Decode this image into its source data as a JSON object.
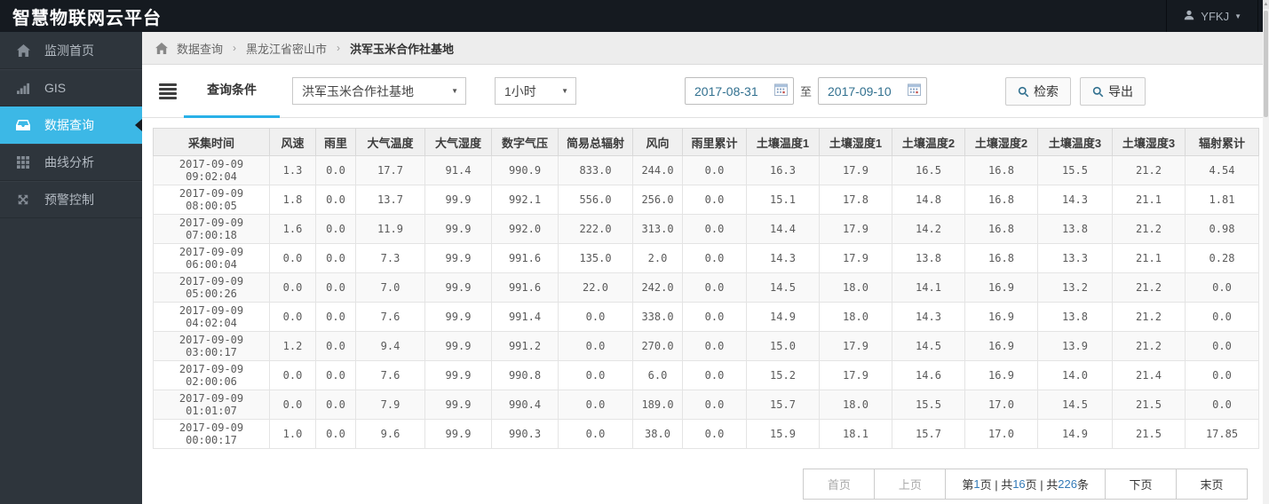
{
  "app": {
    "title": "智慧物联网云平台"
  },
  "user": {
    "name": "YFKJ"
  },
  "sidebar": {
    "items": [
      {
        "id": "monitor-home",
        "label": "监测首页",
        "icon": "home-icon",
        "active": false
      },
      {
        "id": "gis",
        "label": "GIS",
        "icon": "signal-bars-icon",
        "active": false
      },
      {
        "id": "data-query",
        "label": "数据查询",
        "icon": "inbox-icon",
        "active": true
      },
      {
        "id": "curve-analysis",
        "label": "曲线分析",
        "icon": "grid-icon",
        "active": false
      },
      {
        "id": "alert-control",
        "label": "预警控制",
        "icon": "expand-arrows-icon",
        "active": false
      }
    ]
  },
  "breadcrumb": {
    "items": [
      "数据查询",
      "黑龙江省密山市",
      "洪军玉米合作社基地"
    ]
  },
  "query": {
    "panel_label": "查询条件",
    "site_selected": "洪军玉米合作社基地",
    "interval_selected": "1小时",
    "date_from": "2017-08-31",
    "to_label": "至",
    "date_to": "2017-09-10",
    "search_label": "检索",
    "export_label": "导出"
  },
  "table": {
    "headers": [
      "采集时间",
      "风速",
      "雨里",
      "大气温度",
      "大气湿度",
      "数字气压",
      "简易总辐射",
      "风向",
      "雨里累计",
      "土壤温度1",
      "土壤湿度1",
      "土壤温度2",
      "土壤湿度2",
      "土壤温度3",
      "土壤湿度3",
      "辐射累计"
    ],
    "rows": [
      [
        "2017-09-09 09:02:04",
        "1.3",
        "0.0",
        "17.7",
        "91.4",
        "990.9",
        "833.0",
        "244.0",
        "0.0",
        "16.3",
        "17.9",
        "16.5",
        "16.8",
        "15.5",
        "21.2",
        "4.54"
      ],
      [
        "2017-09-09 08:00:05",
        "1.8",
        "0.0",
        "13.7",
        "99.9",
        "992.1",
        "556.0",
        "256.0",
        "0.0",
        "15.1",
        "17.8",
        "14.8",
        "16.8",
        "14.3",
        "21.1",
        "1.81"
      ],
      [
        "2017-09-09 07:00:18",
        "1.6",
        "0.0",
        "11.9",
        "99.9",
        "992.0",
        "222.0",
        "313.0",
        "0.0",
        "14.4",
        "17.9",
        "14.2",
        "16.8",
        "13.8",
        "21.2",
        "0.98"
      ],
      [
        "2017-09-09 06:00:04",
        "0.0",
        "0.0",
        "7.3",
        "99.9",
        "991.6",
        "135.0",
        "2.0",
        "0.0",
        "14.3",
        "17.9",
        "13.8",
        "16.8",
        "13.3",
        "21.1",
        "0.28"
      ],
      [
        "2017-09-09 05:00:26",
        "0.0",
        "0.0",
        "7.0",
        "99.9",
        "991.6",
        "22.0",
        "242.0",
        "0.0",
        "14.5",
        "18.0",
        "14.1",
        "16.9",
        "13.2",
        "21.2",
        "0.0"
      ],
      [
        "2017-09-09 04:02:04",
        "0.0",
        "0.0",
        "7.6",
        "99.9",
        "991.4",
        "0.0",
        "338.0",
        "0.0",
        "14.9",
        "18.0",
        "14.3",
        "16.9",
        "13.8",
        "21.2",
        "0.0"
      ],
      [
        "2017-09-09 03:00:17",
        "1.2",
        "0.0",
        "9.4",
        "99.9",
        "991.2",
        "0.0",
        "270.0",
        "0.0",
        "15.0",
        "17.9",
        "14.5",
        "16.9",
        "13.9",
        "21.2",
        "0.0"
      ],
      [
        "2017-09-09 02:00:06",
        "0.0",
        "0.0",
        "7.6",
        "99.9",
        "990.8",
        "0.0",
        "6.0",
        "0.0",
        "15.2",
        "17.9",
        "14.6",
        "16.9",
        "14.0",
        "21.4",
        "0.0"
      ],
      [
        "2017-09-09 01:01:07",
        "0.0",
        "0.0",
        "7.9",
        "99.9",
        "990.4",
        "0.0",
        "189.0",
        "0.0",
        "15.7",
        "18.0",
        "15.5",
        "17.0",
        "14.5",
        "21.5",
        "0.0"
      ],
      [
        "2017-09-09 00:00:17",
        "1.0",
        "0.0",
        "9.6",
        "99.9",
        "990.3",
        "0.0",
        "38.0",
        "0.0",
        "15.9",
        "18.1",
        "15.7",
        "17.0",
        "14.9",
        "21.5",
        "17.85"
      ]
    ]
  },
  "pagination": {
    "first_label": "首页",
    "prev_label": "上页",
    "next_label": "下页",
    "last_label": "末页",
    "info": {
      "seg1": "第",
      "current_page": "1",
      "seg2": "页 | 共",
      "total_pages": "16",
      "seg3": "页 | 共",
      "total_records": "226",
      "seg4": "条"
    }
  },
  "colors": {
    "accent_blue": "#3cb8e6",
    "tab_underline": "#29b1e8",
    "link_blue": "#337ab7",
    "date_text": "#31708f"
  }
}
